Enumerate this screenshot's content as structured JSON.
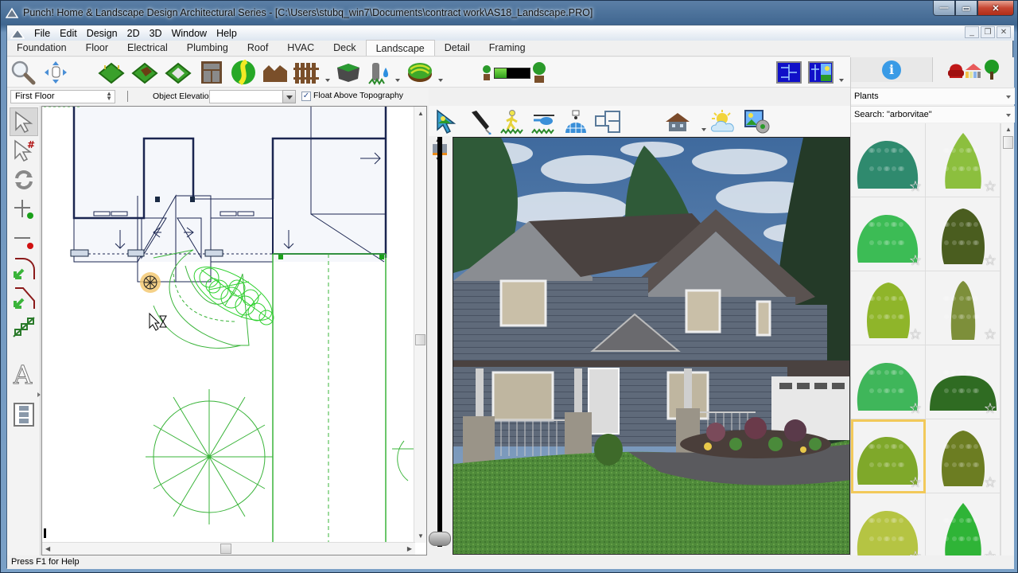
{
  "window": {
    "title": "Punch! Home & Landscape Design Architectural Series - [C:\\Users\\stubq_win7\\Documents\\contract work\\AS18_Landscape.PRO]",
    "controls": {
      "minimize": "—",
      "maximize": "▭",
      "close": "✕"
    },
    "mdi_controls": {
      "minimize": "_",
      "restore": "❐",
      "close": "✕"
    }
  },
  "menu": {
    "items": [
      {
        "label": "File"
      },
      {
        "label": "Edit"
      },
      {
        "label": "Design"
      },
      {
        "label": "2D"
      },
      {
        "label": "3D"
      },
      {
        "label": "Window"
      },
      {
        "label": "Help"
      }
    ]
  },
  "tabs": {
    "items": [
      {
        "label": "Foundation",
        "active": false
      },
      {
        "label": "Floor",
        "active": false
      },
      {
        "label": "Electrical",
        "active": false
      },
      {
        "label": "Plumbing",
        "active": false
      },
      {
        "label": "Roof",
        "active": false
      },
      {
        "label": "HVAC",
        "active": false
      },
      {
        "label": "Deck",
        "active": false
      },
      {
        "label": "Landscape",
        "active": true
      },
      {
        "label": "Detail",
        "active": false
      },
      {
        "label": "Framing",
        "active": false
      }
    ]
  },
  "toolbar": {
    "tools": [
      "zoom-magnifier-icon",
      "pan-hand-icon",
      "terrain-region-icon",
      "planting-bed-icon",
      "pad-icon",
      "cabinet-icon",
      "path-icon",
      "retaining-wall-icon",
      "fence-icon",
      "pond-icon",
      "sprinkler-icon",
      "topography-icon"
    ],
    "plant_age_slider": {
      "value_percent": 35,
      "fill_color": "#4caf1e"
    },
    "view_buttons": [
      "floor-plan-view-icon",
      "split-view-icon"
    ]
  },
  "options": {
    "floor": "First Floor",
    "elevation_label": "Object Elevation:",
    "elevation_value": "",
    "float_label": "Float Above Topography",
    "float_checked": true,
    "check_mark": "✓"
  },
  "camera_tools": [
    "select-3d-icon",
    "eyedropper-icon",
    "walkthrough-icon",
    "fly-helicopter-icon",
    "globe-orbit-icon",
    "floorplan-icon",
    "house-view-icon",
    "sun-weather-icon",
    "render-settings-icon"
  ],
  "right_panel": {
    "tabs": [
      "info-icon",
      "library-icon"
    ],
    "info_glyph": "i",
    "category": "Plants",
    "search": "Search: \"arborvitae\"",
    "plants": [
      {
        "color": "#2f8a6e",
        "shape": "round",
        "selected": false
      },
      {
        "color": "#8cbf3e",
        "shape": "conic",
        "selected": false
      },
      {
        "color": "#3cbc55",
        "shape": "round",
        "selected": false
      },
      {
        "color": "#4a5d1f",
        "shape": "oval",
        "selected": false
      },
      {
        "color": "#8fb52a",
        "shape": "oval",
        "selected": false
      },
      {
        "color": "#7d8f3a",
        "shape": "column",
        "selected": false
      },
      {
        "color": "#3fb65a",
        "shape": "round",
        "selected": false
      },
      {
        "color": "#2f6b22",
        "shape": "low",
        "selected": false
      },
      {
        "color": "#7fa82a",
        "shape": "round",
        "selected": true
      },
      {
        "color": "#6c7d22",
        "shape": "oval",
        "selected": false
      },
      {
        "color": "#b5c443",
        "shape": "round",
        "selected": false
      },
      {
        "color": "#2fb437",
        "shape": "conic",
        "selected": false
      }
    ],
    "star_glyph": "☆"
  },
  "status": {
    "text": "Press F1 for Help"
  }
}
